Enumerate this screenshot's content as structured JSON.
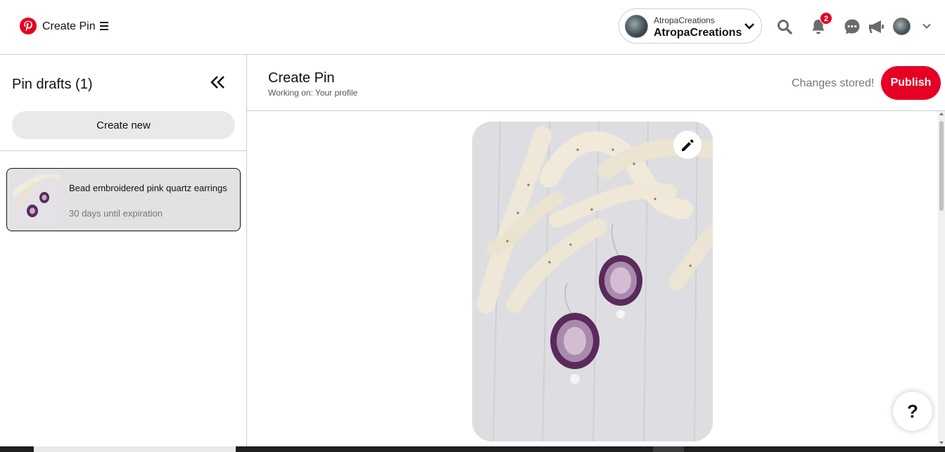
{
  "header": {
    "title": "Create Pin",
    "account_switcher": {
      "small_name": "AtropaCreations",
      "name": "AtropaCreations"
    },
    "notification_count": "2",
    "icons": [
      "pinterest-logo",
      "menu-icon",
      "search-icon",
      "bell-icon",
      "chat-icon",
      "megaphone-icon",
      "user-avatar",
      "chevron-down-icon"
    ]
  },
  "sidebar": {
    "title": "Pin drafts",
    "count": "(1)",
    "create_new_label": "Create new",
    "drafts": [
      {
        "title": "Bead embroidered pink quartz earrings",
        "expiration": "30 days until expiration"
      }
    ]
  },
  "main": {
    "title": "Create Pin",
    "working_on": "Working on: Your profile",
    "status": "Changes stored!",
    "publish_label": "Publish"
  },
  "help": {
    "label": "?"
  },
  "colors": {
    "brand_red": "#e60023",
    "selected_draft_bg": "#e2e2e2",
    "button_gray": "#e9e9e9"
  }
}
